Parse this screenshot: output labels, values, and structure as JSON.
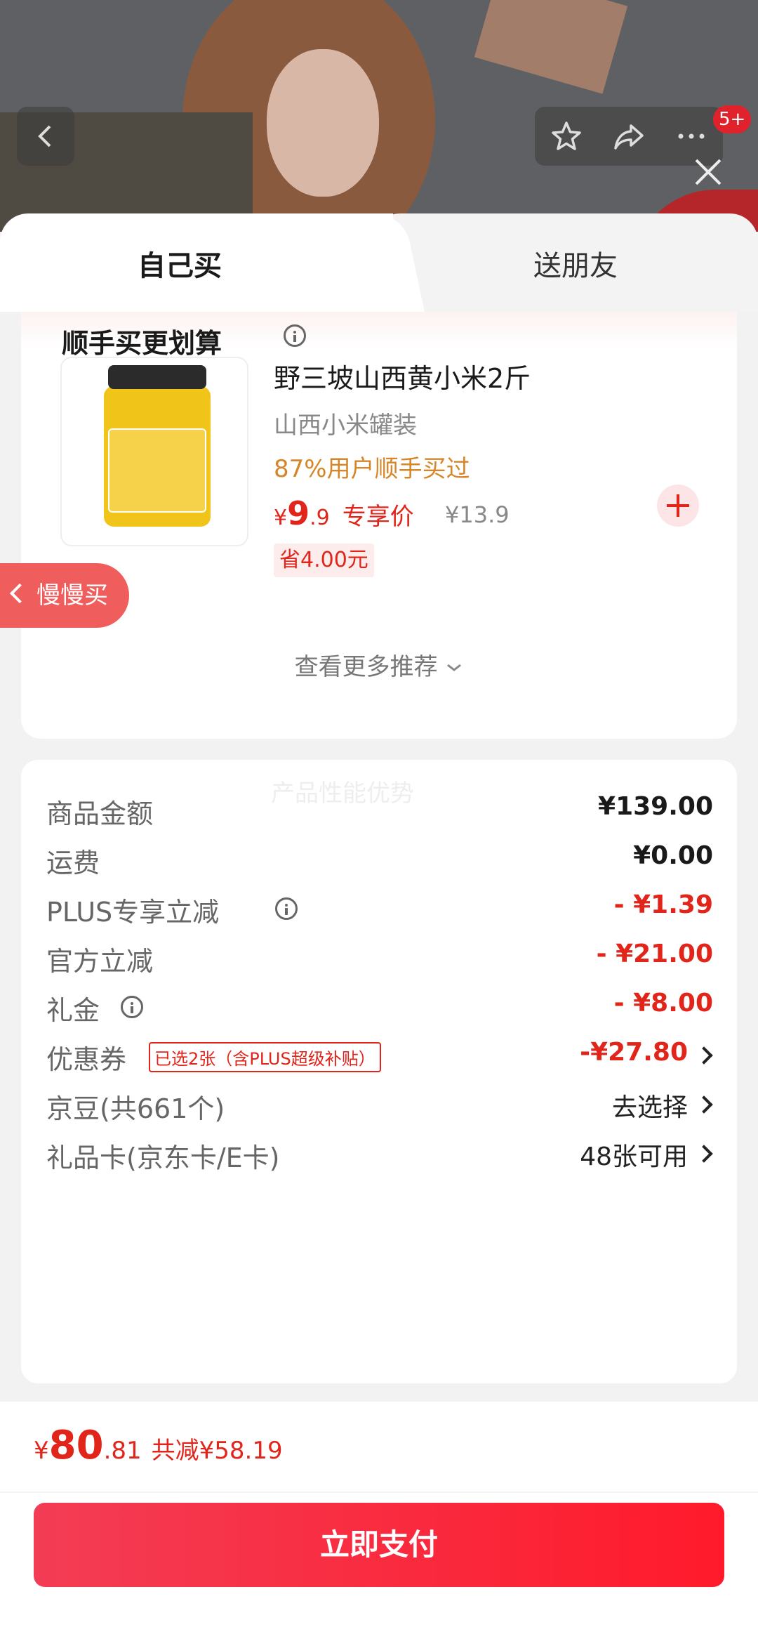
{
  "header": {
    "badge": "5+",
    "icons": [
      "back-icon",
      "star-icon",
      "share-icon",
      "more-icon",
      "close-icon"
    ]
  },
  "tabs": {
    "own": "自己买",
    "friend": "送朋友"
  },
  "recommend": {
    "title": "顺手买更划算",
    "product": {
      "name": "野三坡山西黄小米2斤",
      "subtitle": "山西小米罐装",
      "bought": "87%用户顺手买过",
      "price_symbol": "¥",
      "price_int": "9",
      "price_dec": ".9",
      "price_tag": "专享价",
      "original_price": "¥13.9",
      "save": "省4.00元"
    },
    "more": "查看更多推荐",
    "slow_buy": "慢慢买"
  },
  "details": {
    "watermark": "产品性能优势",
    "rows": [
      {
        "label": "商品金额",
        "value": "¥139.00"
      },
      {
        "label": "运费",
        "value": "¥0.00"
      },
      {
        "label": "PLUS专享立减",
        "value": "- ¥1.39"
      },
      {
        "label": "官方立减",
        "value": "- ¥21.00"
      },
      {
        "label": "礼金",
        "value": "- ¥8.00"
      },
      {
        "label": "优惠券",
        "tag": "已选2张（含PLUS超级补贴）",
        "value": "-¥27.80"
      },
      {
        "label": "京豆(共661个)",
        "value": "去选择"
      },
      {
        "label": "礼品卡(京东卡/E卡)",
        "value": "48张可用"
      }
    ]
  },
  "footer": {
    "total_symbol": "¥",
    "total_int": "80",
    "total_dec": ".81",
    "total_saved": "共减¥58.19",
    "pay_label": "立即支付"
  },
  "colors": {
    "accent_red": "#e1251b",
    "orange": "#d68628"
  }
}
